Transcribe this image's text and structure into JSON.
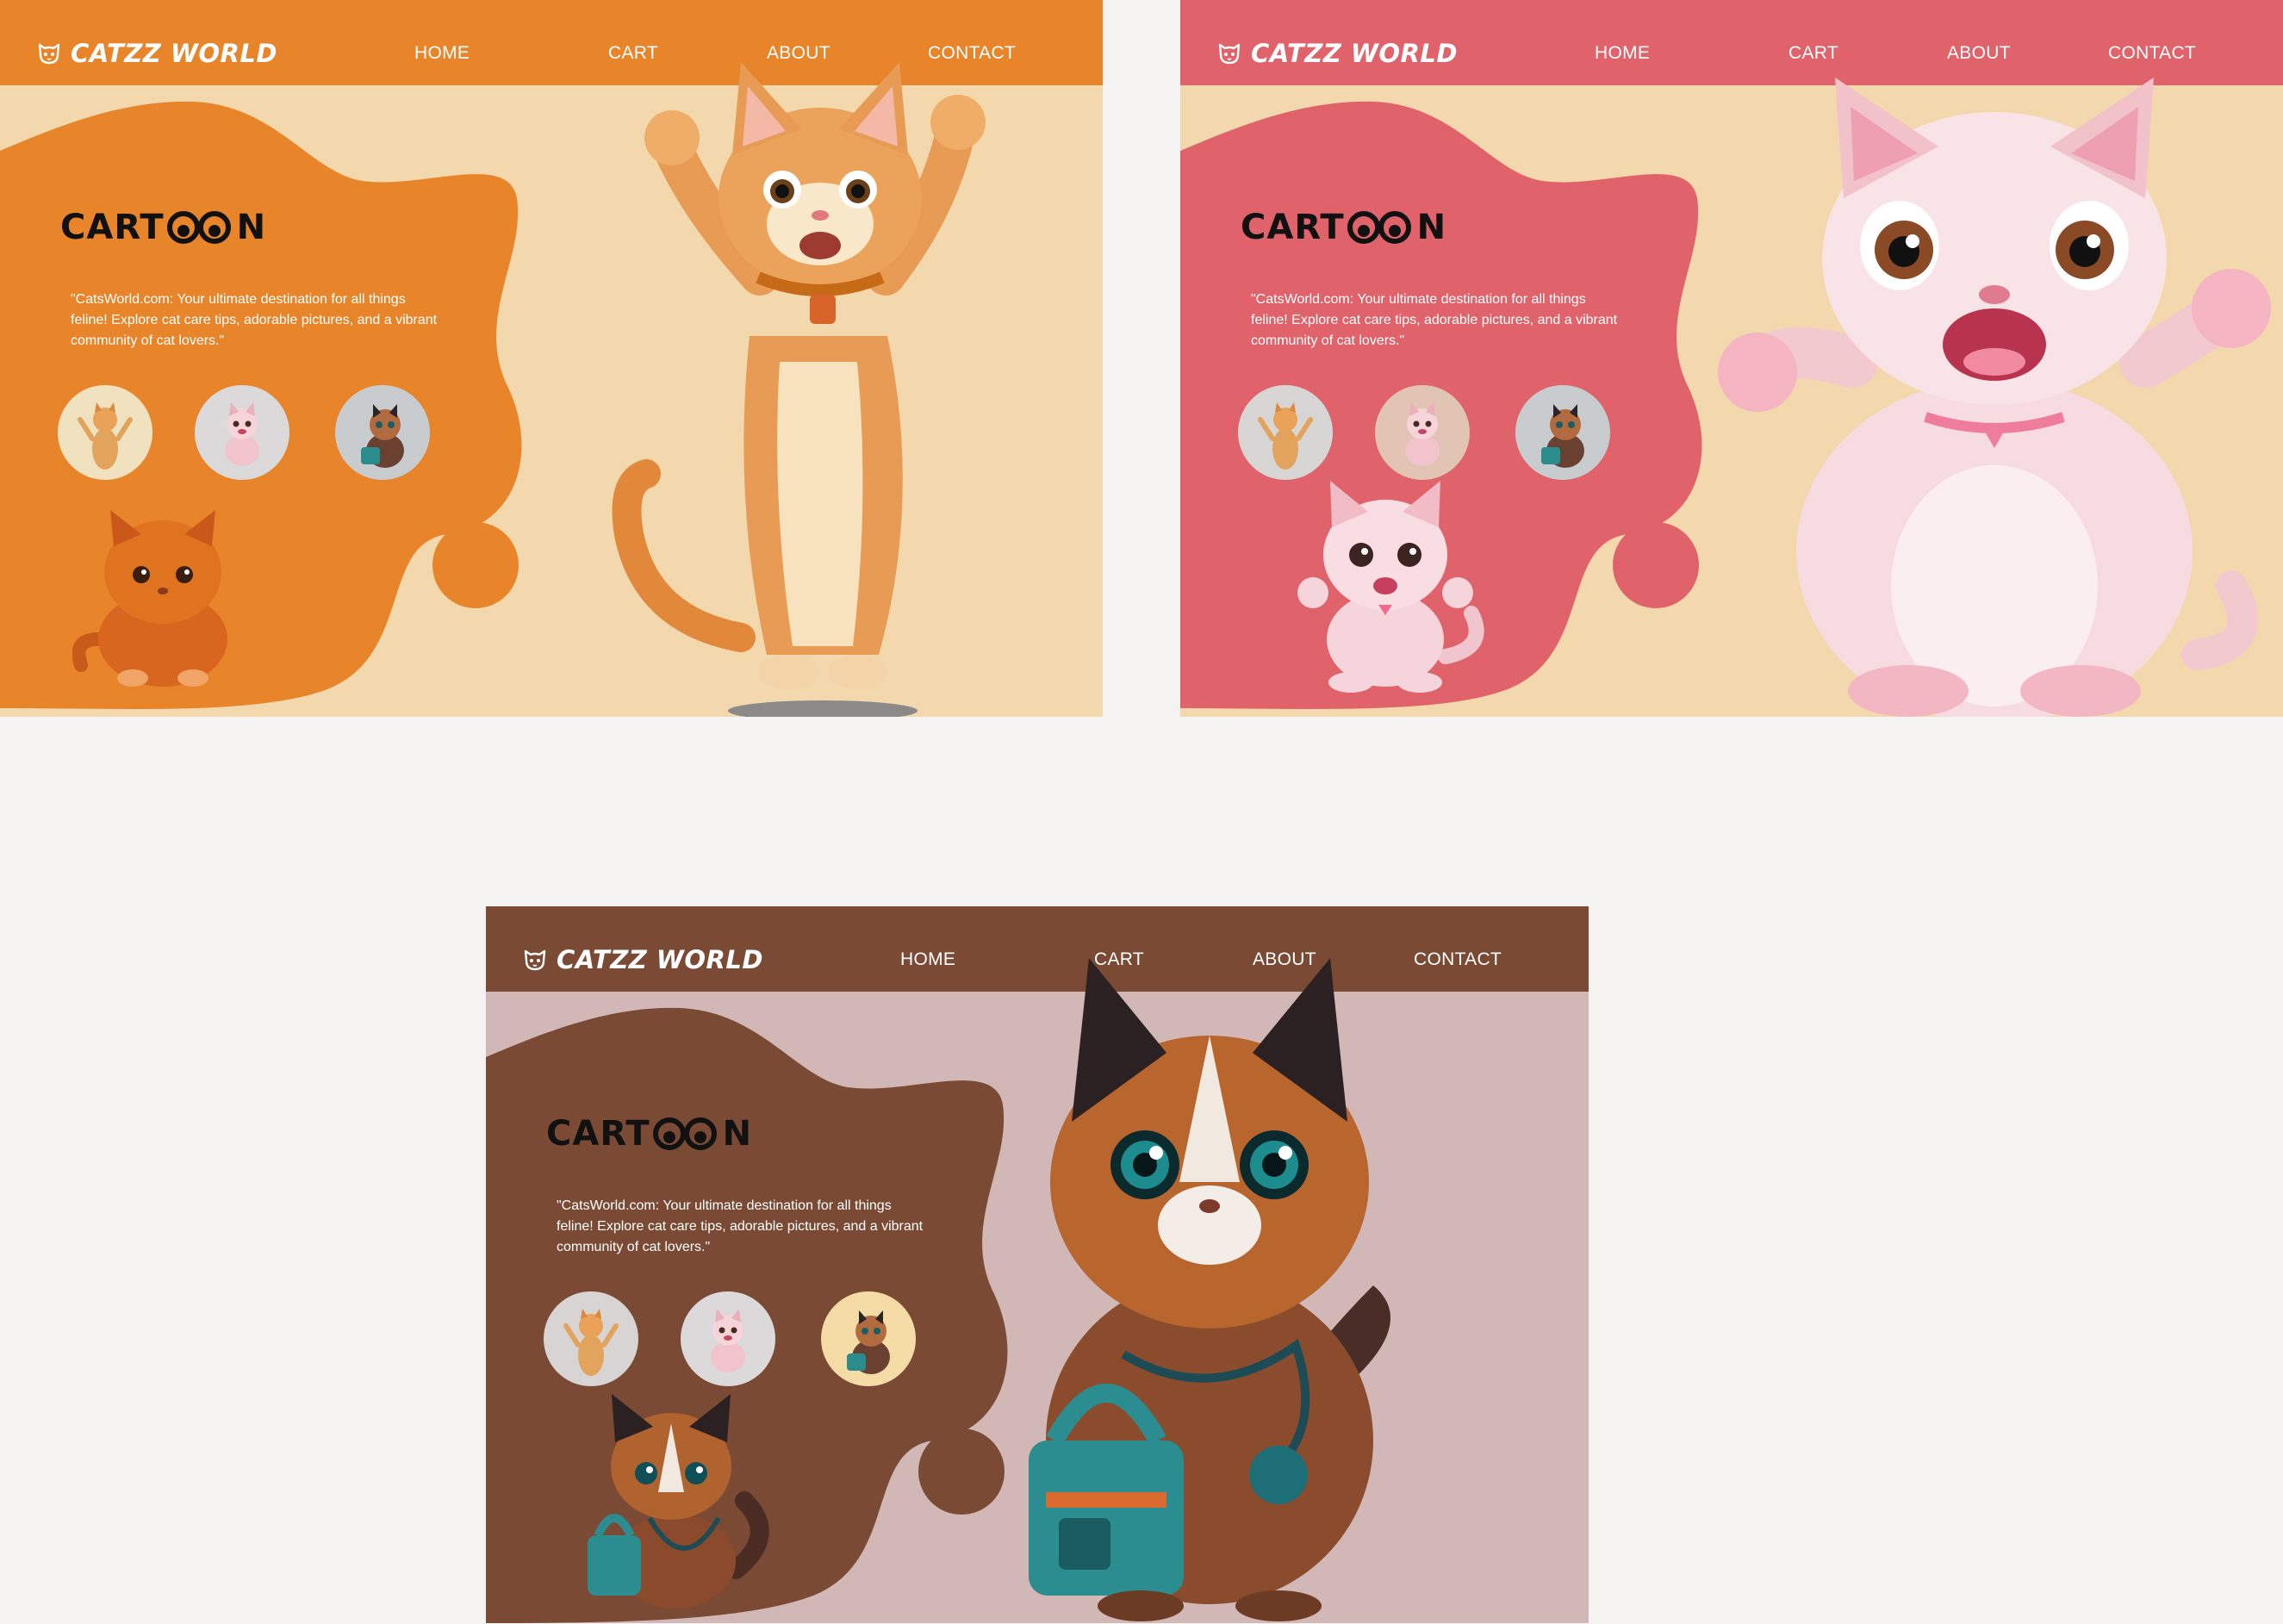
{
  "brand": {
    "name": "CATZZ WORLD",
    "logo_icon": "cat-face-icon"
  },
  "nav": {
    "home": "HOME",
    "cart": "CART",
    "about": "ABOUT",
    "contact": "CONTACT"
  },
  "hero": {
    "title": "CART",
    "title_suffix": "N",
    "description": "\"CatsWorld.com: Your ultimate destination for all things feline! Explore cat care tips, adorable pictures, and a vibrant community of cat lovers.\""
  },
  "thumbnails": [
    "orange-tabby-cat-thumbnail",
    "pink-kitten-thumbnail",
    "calico-doctor-cat-thumbnail"
  ],
  "themes": {
    "orange": {
      "accent": "#e8852a",
      "background": "#f2d8ac",
      "active_thumbnail": "none"
    },
    "pink": {
      "accent": "#e0626a",
      "background": "#f2d8ac",
      "active_thumbnail": "pink-kitten-thumbnail"
    },
    "brown": {
      "accent": "#7a4a35",
      "background": "#d1b7b6",
      "active_thumbnail": "calico-doctor-cat-thumbnail"
    }
  }
}
